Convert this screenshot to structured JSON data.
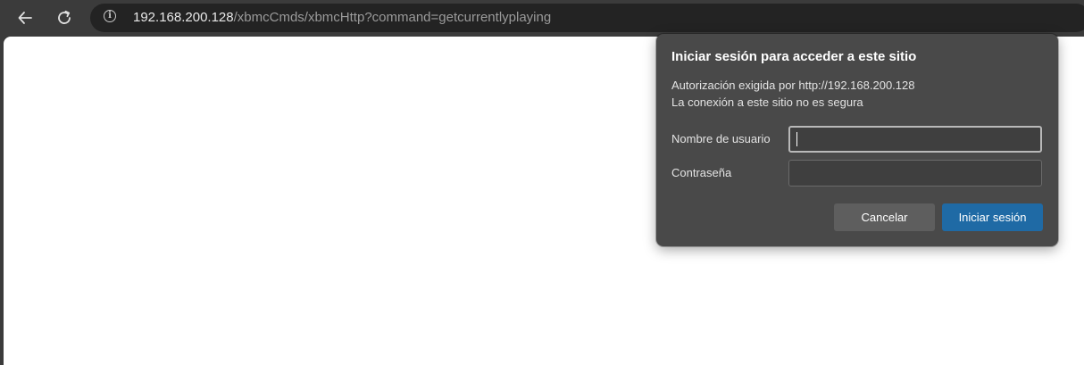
{
  "toolbar": {
    "back_icon": "arrow-left-icon",
    "reload_icon": "reload-icon",
    "info_icon": "info-icon",
    "url_host": "192.168.200.128",
    "url_path": "/xbmcCmds/xbmcHttp?command=getcurrentlyplaying"
  },
  "dialog": {
    "title": "Iniciar sesión para acceder a este sitio",
    "auth_line": "Autorización exigida por http://192.168.200.128",
    "security_line": "La conexión a este sitio no es segura",
    "username_label": "Nombre de usuario",
    "username_value": "",
    "password_label": "Contraseña",
    "password_value": "",
    "cancel_label": "Cancelar",
    "login_label": "Iniciar sesión",
    "colors": {
      "background": "#494949",
      "primary_button": "#1f6aa5",
      "secondary_button": "#5e5e5e"
    }
  }
}
